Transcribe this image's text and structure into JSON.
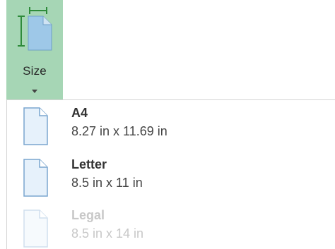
{
  "size_button": {
    "label": "Size"
  },
  "paper_sizes": [
    {
      "name": "A4",
      "dimensions": "8.27 in x 11.69 in"
    },
    {
      "name": "Letter",
      "dimensions": "8.5 in x 11 in"
    },
    {
      "name": "Legal",
      "dimensions": "8.5 in x 14 in"
    }
  ],
  "colors": {
    "button_background": "#a6d6b5",
    "dimension_marker": "#2e8b3a",
    "page_fill": "#e6f1fb",
    "page_stroke": "#7aa6cf"
  }
}
